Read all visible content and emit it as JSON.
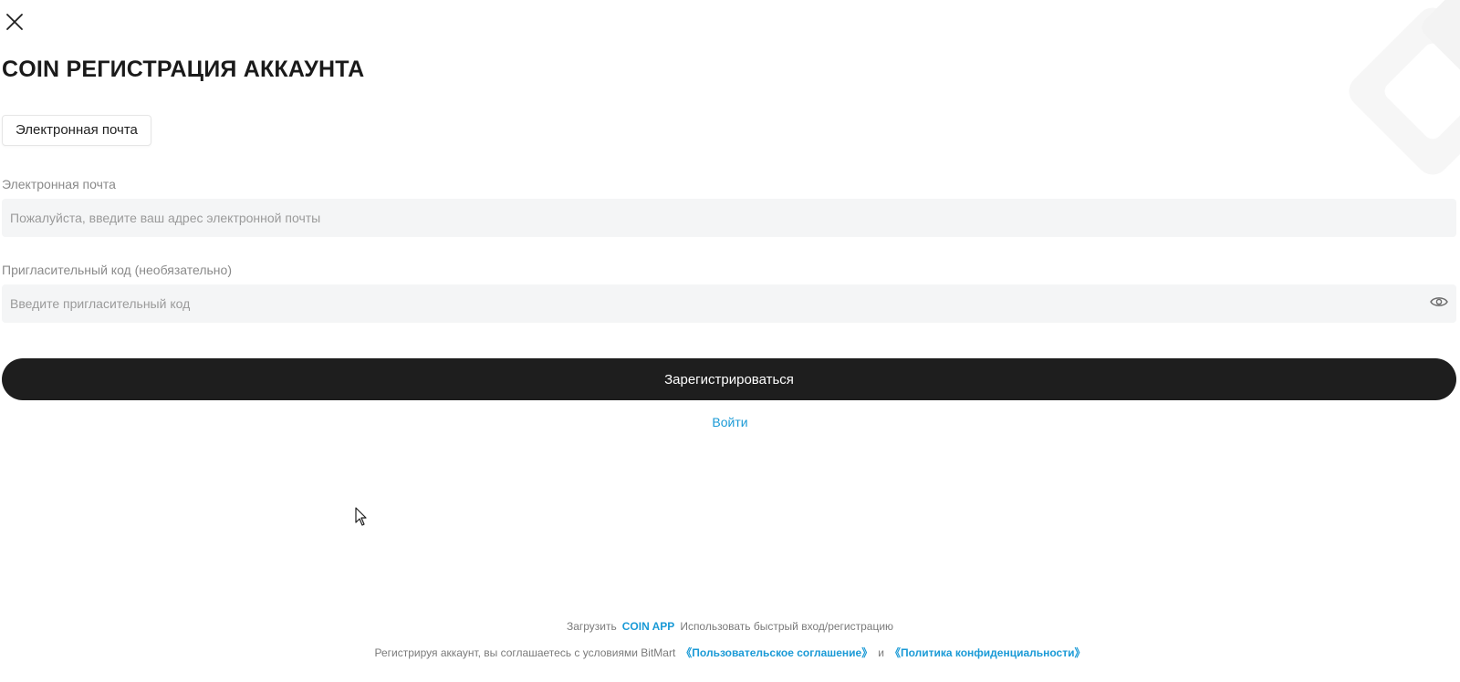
{
  "header": {
    "close_icon": "close-icon",
    "title": "COIN РЕГИСТРАЦИЯ АККАУНТА"
  },
  "tabs": {
    "email_tab": "Электронная почта"
  },
  "form": {
    "email": {
      "label": "Электронная почта",
      "value": "",
      "placeholder": "Пожалуйста, введите ваш адрес электронной почты"
    },
    "invite": {
      "label": "Пригласительный код (необязательно)",
      "value": "",
      "placeholder": "Введите пригласительный код",
      "toggle_icon": "eye-icon"
    },
    "submit_label": "Зарегистрироваться",
    "login_label": "Войти"
  },
  "footer": {
    "download_prefix": "Загрузить",
    "app_link": "COIN APP",
    "download_suffix": "Использовать быстрый вход/регистрацию",
    "agreement_prefix": "Регистрируя аккаунт, вы соглашаетесь с условиями BitMart",
    "user_agreement": "《Пользовательское соглашение》",
    "and": "и",
    "privacy_policy": "《Политика конфиденциальности》"
  },
  "colors": {
    "accent": "#1a9ad6",
    "primary_button": "#1e1e1e",
    "input_bg": "#f4f5f6"
  }
}
